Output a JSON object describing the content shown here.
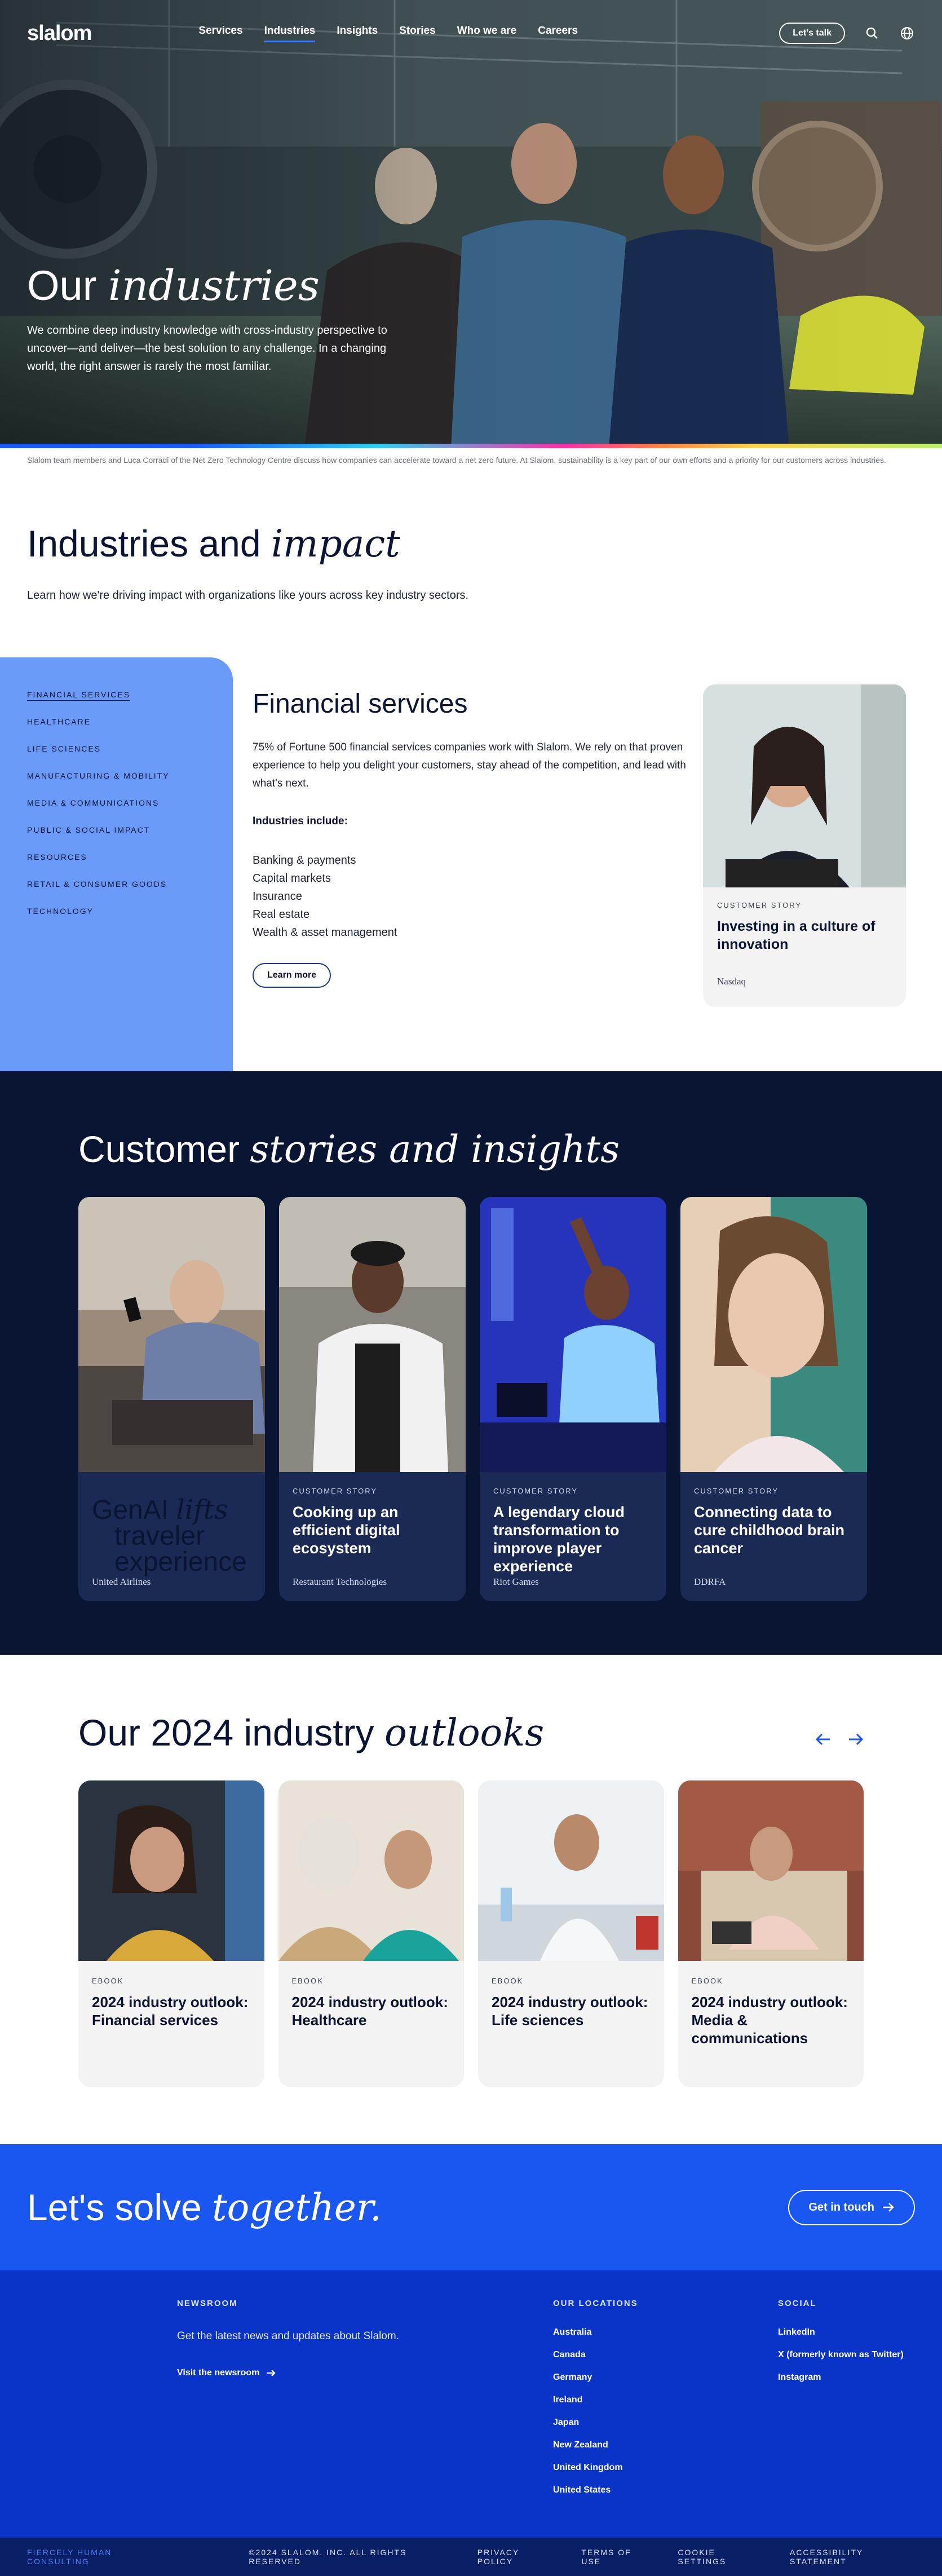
{
  "nav": {
    "logo": "slalom",
    "links": [
      "Services",
      "Industries",
      "Insights",
      "Stories",
      "Who we are",
      "Careers"
    ],
    "cta": "Let's talk"
  },
  "hero": {
    "title_light": "Our ",
    "title_italic": "industries",
    "subtitle": "We combine deep industry knowledge with cross-industry perspective to uncover—and deliver—the best solution to any challenge. In a changing world, the right answer is rarely the most familiar.",
    "caption": "Slalom team members and Luca Corradi of the Net Zero Technology Centre discuss how companies can accelerate toward a net zero future. At Slalom, sustainability is a key part of our own efforts and a priority for our customers across industries."
  },
  "impact": {
    "title_light": "Industries and ",
    "title_italic": "impact",
    "subtitle": "Learn how we're driving impact with organizations like yours across key industry sectors."
  },
  "industries": {
    "menu": [
      "Financial services",
      "Healthcare",
      "Life sciences",
      "Manufacturing & mobility",
      "Media & communications",
      "Public & social impact",
      "Resources",
      "Retail & consumer goods",
      "Technology"
    ],
    "active_title": "Financial services",
    "description": "75% of Fortune 500 financial services companies work with Slalom. We rely on that proven experience to help you delight your customers, stay ahead of the competition, and lead with what's next.",
    "includes_label": "Industries include:",
    "includes": [
      "Banking & payments",
      "Capital markets",
      "Insurance",
      "Real estate",
      "Wealth & asset management"
    ],
    "learn_more": "Learn more",
    "card": {
      "kicker": "Customer story",
      "title": "Investing in a culture of innovation",
      "source": "Nasdaq"
    }
  },
  "stories": {
    "title_light": "Customer ",
    "title_italic": "stories and insights",
    "cards": [
      {
        "kicker": "",
        "title": "",
        "overlay": [
          "GenAI ",
          "lifts",
          "traveler",
          "experience"
        ],
        "source": "United Airlines"
      },
      {
        "kicker": "Customer story",
        "title": "Cooking up an efficient digital ecosystem",
        "source": "Restaurant Technologies"
      },
      {
        "kicker": "Customer story",
        "title": "A legendary cloud transformation to improve player experience",
        "source": "Riot Games"
      },
      {
        "kicker": "Customer story",
        "title": "Connecting data to cure childhood brain cancer",
        "source": "DDRFA"
      }
    ]
  },
  "outlooks": {
    "title_light": "Our 2024 industry ",
    "title_italic": "outlooks",
    "cards": [
      {
        "kicker": "Ebook",
        "title": "2024 industry outlook: Financial services"
      },
      {
        "kicker": "Ebook",
        "title": "2024 industry outlook: Healthcare"
      },
      {
        "kicker": "Ebook",
        "title": "2024 industry outlook: Life sciences"
      },
      {
        "kicker": "Ebook",
        "title": "2024 industry outlook: Media & communications"
      }
    ]
  },
  "cta": {
    "title_light": "Let's solve ",
    "title_italic": "together.",
    "button": "Get in touch"
  },
  "footer": {
    "newsroom_heading": "NEWSROOM",
    "newsroom_text": "Get the latest news and updates about Slalom.",
    "newsroom_link": "Visit the newsroom",
    "locations_heading": "OUR LOCATIONS",
    "locations": [
      "Australia",
      "Canada",
      "Germany",
      "Ireland",
      "Japan",
      "New Zealand",
      "United Kingdom",
      "United States"
    ],
    "social_heading": "SOCIAL",
    "social": [
      "LinkedIn",
      "X (formerly known as Twitter)",
      "Instagram"
    ],
    "tagline": "FIERCELY HUMAN CONSULTING",
    "copyright": "©2024 SLALOM, INC. ALL RIGHTS RESERVED",
    "legal": [
      "PRIVACY POLICY",
      "TERMS OF USE",
      "COOKIE SETTINGS",
      "ACCESSIBILITY STATEMENT"
    ]
  },
  "colors": {
    "navy": "#0a1433",
    "accent_blue": "#1a57f0",
    "sidebar_blue": "#6a9af7",
    "footer_blue": "#0a34c8"
  }
}
